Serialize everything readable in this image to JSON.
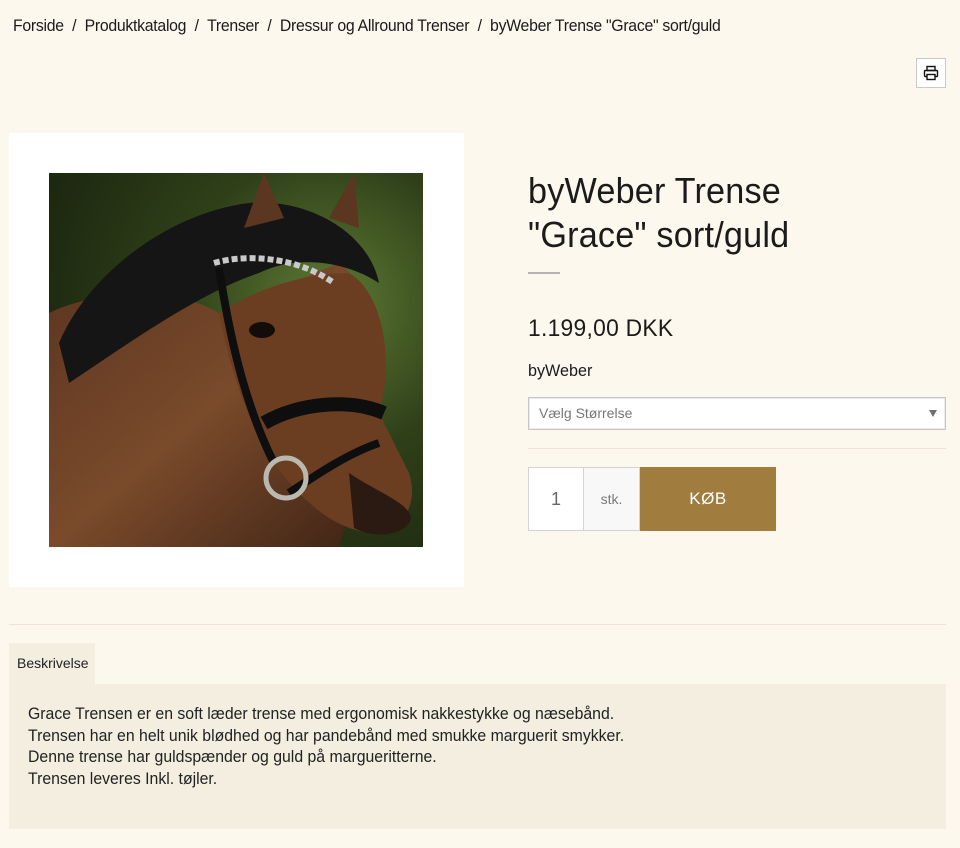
{
  "breadcrumb": {
    "items": [
      "Forside",
      "Produktkatalog",
      "Trenser",
      "Dressur og Allround Trenser",
      "byWeber Trense \"Grace\" sort/guld"
    ],
    "separator": "/"
  },
  "toolbar": {
    "print_icon": "printer-icon"
  },
  "product": {
    "title": "byWeber Trense \"Grace\" sort/guld",
    "price": "1.199,00 DKK",
    "brand": "byWeber",
    "size_select": {
      "placeholder": "Vælg Størrelse"
    },
    "quantity": "1",
    "unit": "stk.",
    "buy_label": "KØB"
  },
  "tabs": {
    "description_label": "Beskrivelse"
  },
  "description": {
    "lines": [
      "Grace Trensen er en soft læder trense med ergonomisk nakkestykke og næsebånd.",
      "Trensen har en helt unik blødhed og har pandebånd med smukke marguerit smykker.",
      "Denne trense har guldspænder og guld på margueritterne.",
      "Trensen leveres Inkl. tøjler."
    ]
  },
  "colors": {
    "background": "#fdf8ee",
    "accent": "#a17c3f",
    "panel": "#f3eee0"
  }
}
